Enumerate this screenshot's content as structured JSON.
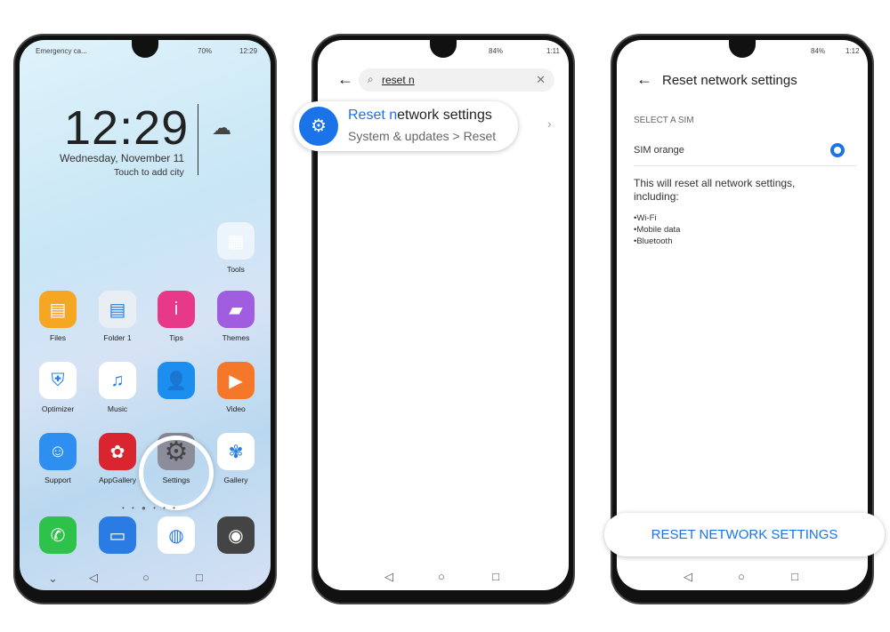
{
  "phone1": {
    "status_left": "Emergency ca...",
    "status_right": "70%",
    "status_time": "12:29",
    "clock": "12:29",
    "date": "Wednesday, November 11",
    "city": "Touch to add city",
    "folder_tools": "Tools",
    "apps": [
      {
        "label": "Files",
        "color": "#f5a623",
        "icon": "folder-icon"
      },
      {
        "label": "Folder 1",
        "color": "#e8eef4",
        "icon": "folder-icon"
      },
      {
        "label": "Tips",
        "color": "#e8388a",
        "icon": "tips-icon"
      },
      {
        "label": "Themes",
        "color": "#a15de0",
        "icon": "brush-icon"
      },
      {
        "label": "Optimizer",
        "color": "#ffffff",
        "icon": "shield-icon"
      },
      {
        "label": "Music",
        "color": "#ffffff",
        "icon": "music-icon"
      },
      {
        "label": "",
        "color": "#1c8ef0",
        "icon": "contacts-icon"
      },
      {
        "label": "Video",
        "color": "#f5772a",
        "icon": "play-icon"
      },
      {
        "label": "Support",
        "color": "#2f8ff0",
        "icon": "support-icon"
      },
      {
        "label": "AppGallery",
        "color": "#d9252f",
        "icon": "huawei-icon"
      },
      {
        "label": "Settings",
        "color": "#8c8c9a",
        "icon": "gear-icon"
      },
      {
        "label": "Gallery",
        "color": "#ffffff",
        "icon": "flower-icon"
      }
    ],
    "dock": [
      {
        "color": "#2ec24a",
        "icon": "phone-icon"
      },
      {
        "color": "#2a7be4",
        "icon": "message-icon"
      },
      {
        "color": "#ffffff",
        "icon": "browser-icon"
      },
      {
        "color": "#444444",
        "icon": "camera-icon"
      }
    ]
  },
  "phone2": {
    "status_right": "84%",
    "status_time": "1:11",
    "search_value": "reset n",
    "result_title_match": "Reset n",
    "result_title_rest": "etwork settings",
    "result_path": "System & updates > Reset"
  },
  "phone3": {
    "status_right": "84%",
    "status_time": "1:12",
    "title": "Reset network settings",
    "section": "SELECT A SIM",
    "sim_label": "SIM  orange",
    "description": "This will reset all network settings, including:",
    "bullets": [
      "Wi-Fi",
      "Mobile data",
      "Bluetooth"
    ],
    "button": "RESET NETWORK SETTINGS",
    "accent": "#1a73e8"
  }
}
